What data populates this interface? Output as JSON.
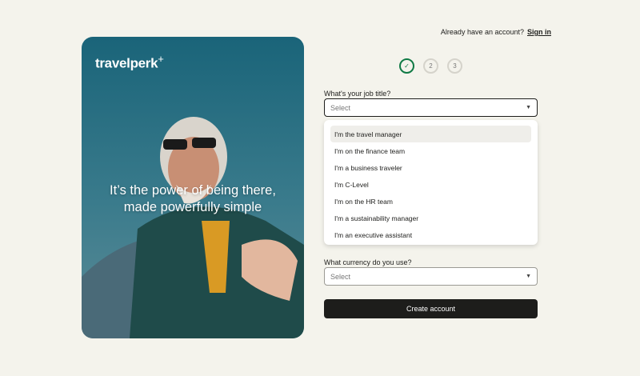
{
  "hero": {
    "logo": "travelperk",
    "logo_plus": "+",
    "tagline_line1": "It’s the power of being there,",
    "tagline_line2": "made powerfully simple"
  },
  "header": {
    "prompt": "Already have an account?",
    "signin": "Sign in"
  },
  "steps": [
    {
      "label": "✓",
      "state": "done"
    },
    {
      "label": "2",
      "state": "pending"
    },
    {
      "label": "3",
      "state": "pending"
    }
  ],
  "job": {
    "label": "What's your job title?",
    "placeholder": "Select",
    "options": [
      "I'm the travel manager",
      "I'm on the finance team",
      "I'm a business traveler",
      "I'm C-Level",
      "I'm on the HR team",
      "I'm a sustainability manager",
      "I'm an executive assistant"
    ]
  },
  "currency": {
    "label": "What currency do you use?",
    "placeholder": "Select"
  },
  "submit": "Create account"
}
